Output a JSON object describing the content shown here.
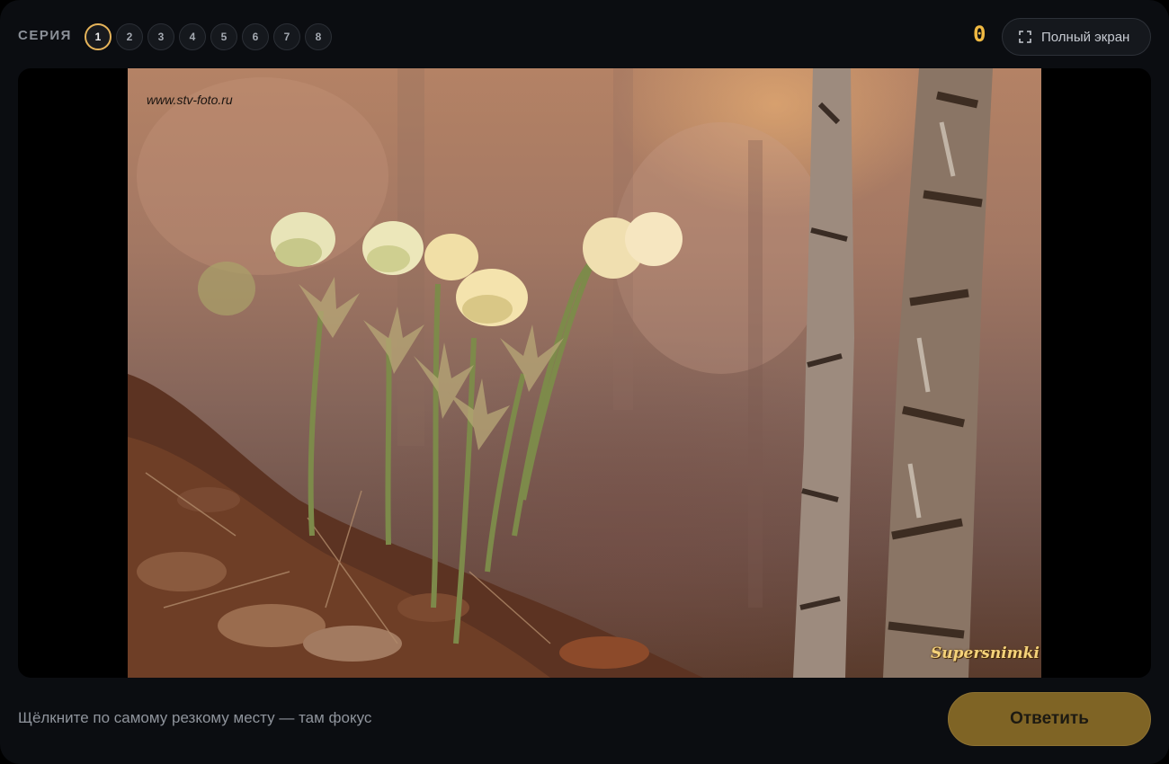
{
  "header": {
    "series_label": "СЕРИЯ",
    "series_items": [
      {
        "label": "1",
        "active": true
      },
      {
        "label": "2",
        "active": false
      },
      {
        "label": "3",
        "active": false
      },
      {
        "label": "4",
        "active": false
      },
      {
        "label": "5",
        "active": false
      },
      {
        "label": "6",
        "active": false
      },
      {
        "label": "7",
        "active": false
      },
      {
        "label": "8",
        "active": false
      }
    ],
    "score": "0",
    "fullscreen_label": "Полный экран",
    "fullscreen_icon": "expand-corners-icon"
  },
  "photo": {
    "description_icon": "photo",
    "watermark_top": "www.stv-foto.ru",
    "watermark_bottom": "Supersnimki"
  },
  "footer": {
    "hint": "Щёлкните по самому резкому месту — там фокус",
    "answer_label": "Ответить"
  },
  "colors": {
    "accent": "#e6b45a",
    "score": "#f0b942",
    "answer_button": "#7f6425",
    "background": "#0b0d11"
  }
}
